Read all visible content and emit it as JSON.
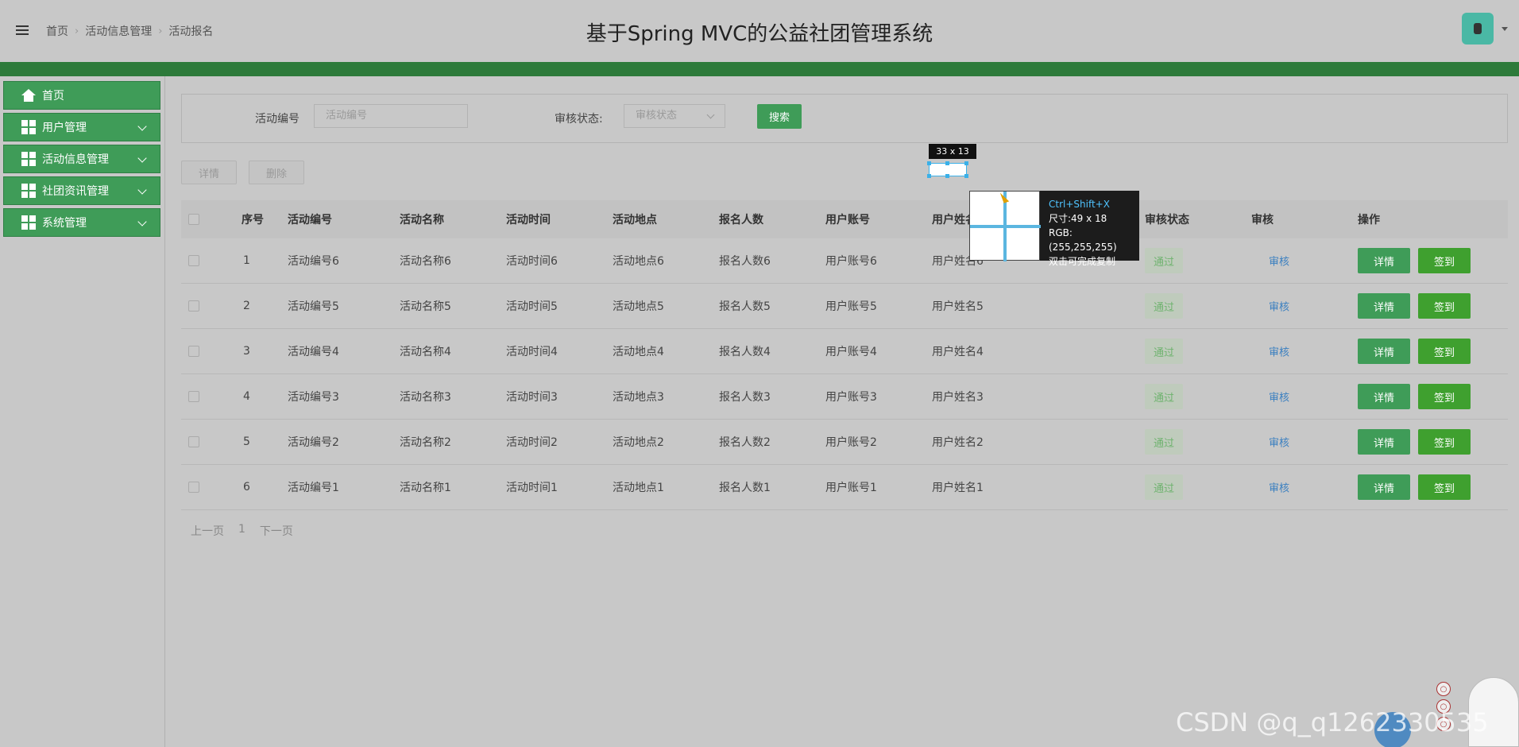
{
  "header": {
    "breadcrumb": [
      "首页",
      "活动信息管理",
      "活动报名"
    ],
    "title": "基于Spring MVC的公益社团管理系统",
    "avatar_icon": "user-avatar-icon"
  },
  "sidebar": {
    "items": [
      {
        "label": "首页",
        "icon": "home-icon"
      },
      {
        "label": "用户管理",
        "icon": "grid-icon"
      },
      {
        "label": "活动信息管理",
        "icon": "grid-icon"
      },
      {
        "label": "社团资讯管理",
        "icon": "grid-icon"
      },
      {
        "label": "系统管理",
        "icon": "grid-icon"
      }
    ]
  },
  "search": {
    "activity_no_label": "活动编号",
    "activity_no_placeholder": "活动编号",
    "status_label": "审核状态:",
    "status_placeholder": "审核状态",
    "search_button": "搜索"
  },
  "toolbar": {
    "detail_label": "详情",
    "delete_label": "删除"
  },
  "table": {
    "columns": [
      "序号",
      "活动编号",
      "活动名称",
      "活动时间",
      "活动地点",
      "报名人数",
      "用户账号",
      "用户姓名",
      "审核状态",
      "审核",
      "操作"
    ],
    "rows": [
      {
        "no": "1",
        "code": "活动编号6",
        "name": "活动名称6",
        "time": "活动时间6",
        "place": "活动地点6",
        "count": "报名人数6",
        "account": "用户账号6",
        "username": "用户姓名6",
        "status": "通过",
        "audit": "审核",
        "detail": "详情",
        "sign": "签到"
      },
      {
        "no": "2",
        "code": "活动编号5",
        "name": "活动名称5",
        "time": "活动时间5",
        "place": "活动地点5",
        "count": "报名人数5",
        "account": "用户账号5",
        "username": "用户姓名5",
        "status": "通过",
        "audit": "审核",
        "detail": "详情",
        "sign": "签到"
      },
      {
        "no": "3",
        "code": "活动编号4",
        "name": "活动名称4",
        "time": "活动时间4",
        "place": "活动地点4",
        "count": "报名人数4",
        "account": "用户账号4",
        "username": "用户姓名4",
        "status": "通过",
        "audit": "审核",
        "detail": "详情",
        "sign": "签到"
      },
      {
        "no": "4",
        "code": "活动编号3",
        "name": "活动名称3",
        "time": "活动时间3",
        "place": "活动地点3",
        "count": "报名人数3",
        "account": "用户账号3",
        "username": "用户姓名3",
        "status": "通过",
        "audit": "审核",
        "detail": "详情",
        "sign": "签到"
      },
      {
        "no": "5",
        "code": "活动编号2",
        "name": "活动名称2",
        "time": "活动时间2",
        "place": "活动地点2",
        "count": "报名人数2",
        "account": "用户账号2",
        "username": "用户姓名2",
        "status": "通过",
        "audit": "审核",
        "detail": "详情",
        "sign": "签到"
      },
      {
        "no": "6",
        "code": "活动编号1",
        "name": "活动名称1",
        "time": "活动时间1",
        "place": "活动地点1",
        "count": "报名人数1",
        "account": "用户账号1",
        "username": "用户姓名1",
        "status": "通过",
        "audit": "审核",
        "detail": "详情",
        "sign": "签到"
      }
    ]
  },
  "pager": {
    "prev": "上一页",
    "page": "1",
    "next": "下一页"
  },
  "overlay": {
    "size_tip": "33 x 13",
    "shortcut": "Ctrl+Shift+X",
    "size": "尺寸:49 x 18",
    "rgb": "RGB:(255,255,255)",
    "hint": "双击可完成复制"
  },
  "watermark": "CSDN @q_q1262330535",
  "colors": {
    "primary_green": "#3f9c58",
    "dark_green_bar": "#2d7a3a",
    "sign_green": "#3fa02f",
    "link_blue": "#3a7fc0"
  }
}
